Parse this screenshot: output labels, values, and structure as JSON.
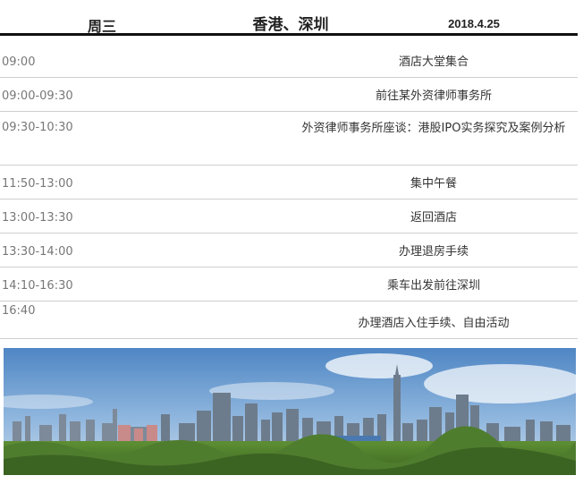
{
  "header": {
    "day": "周三",
    "city": "香港、深圳",
    "date": "2018.4.25"
  },
  "schedule": [
    {
      "time": "09:00",
      "activity": "酒店大堂集合"
    },
    {
      "time": "09:00-09:30",
      "activity": "前往某外资律师事务所"
    },
    {
      "time": "09:30-10:30",
      "activity": "外资律师事务所座谈：港股IPO实务探究及案例分析"
    },
    {
      "time": "11:50-13:00",
      "activity": "集中午餐"
    },
    {
      "time": "13:00-13:30",
      "activity": "返回酒店"
    },
    {
      "time": "13:30-14:00",
      "activity": "办理退房手续"
    },
    {
      "time": "14:10-16:30",
      "activity": "乘车出发前往深圳"
    },
    {
      "time": "16:40",
      "activity": "办理酒店入住手续、自由活动"
    }
  ],
  "photo": {
    "icon": "city-skyline-photo",
    "sky_color": "#5a8fc7",
    "greenery_color": "#4f7d2e"
  }
}
